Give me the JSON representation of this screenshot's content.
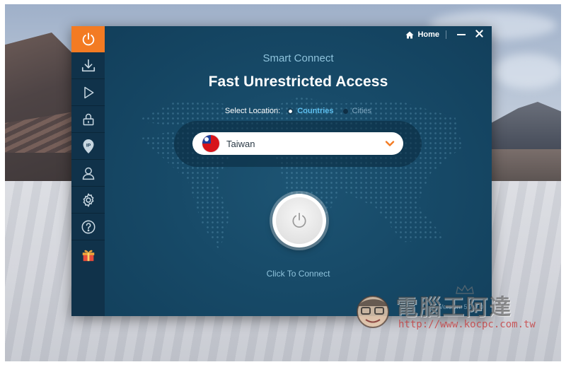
{
  "window": {
    "home_label": "Home",
    "minimize_label": "—",
    "close_label": "✕"
  },
  "sidebar": {
    "items": [
      {
        "name": "power-icon",
        "active": true
      },
      {
        "name": "download-icon",
        "active": false
      },
      {
        "name": "play-icon",
        "active": false
      },
      {
        "name": "lock-icon",
        "active": false
      },
      {
        "name": "ip-pin-icon",
        "active": false
      },
      {
        "name": "user-icon",
        "active": false
      },
      {
        "name": "gear-icon",
        "active": false
      },
      {
        "name": "help-icon",
        "active": false
      },
      {
        "name": "gift-icon",
        "active": false
      }
    ],
    "accent_color": "#f37b23",
    "gift_color": "#e64b3b"
  },
  "main": {
    "subtitle": "Smart Connect",
    "headline": "Fast Unrestricted Access",
    "select_location_label": "Select Location:",
    "location_modes": {
      "countries": "Countries",
      "cities": "Cities",
      "selected": "Countries"
    },
    "location_select": {
      "value": "Taiwan",
      "flag_icon": "taiwan-flag-icon"
    },
    "connect_button_icon": "power-icon",
    "connect_label": "Click To Connect",
    "version": "Version: 5.7.2.0"
  },
  "watermark": {
    "title": "電腦王阿達",
    "url": "http://www.kocpc.com.tw"
  }
}
